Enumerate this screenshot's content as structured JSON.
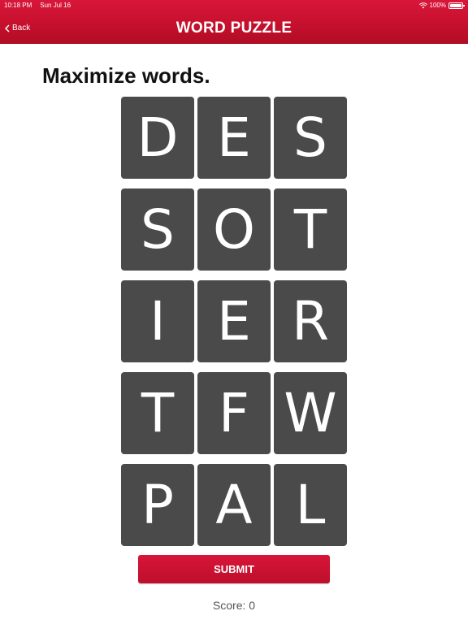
{
  "status_bar": {
    "time": "10:18 PM",
    "date": "Sun Jul 16",
    "battery": "100%"
  },
  "header": {
    "back_label": "Back",
    "title": "WORD PUZZLE"
  },
  "instruction": "Maximize words.",
  "tiles": [
    "D",
    "E",
    "S",
    "S",
    "O",
    "T",
    "I",
    "E",
    "R",
    "T",
    "F",
    "W",
    "P",
    "A",
    "L"
  ],
  "submit_label": "SUBMIT",
  "score": {
    "label": "Score:",
    "value": "0"
  },
  "colors": {
    "header_red": "#c4102c",
    "tile_gray": "#4a4a4a",
    "submit_red": "#c8112f"
  },
  "icons": {
    "back": "chevron-left-icon",
    "wifi": "wifi-icon",
    "battery": "battery-icon"
  }
}
